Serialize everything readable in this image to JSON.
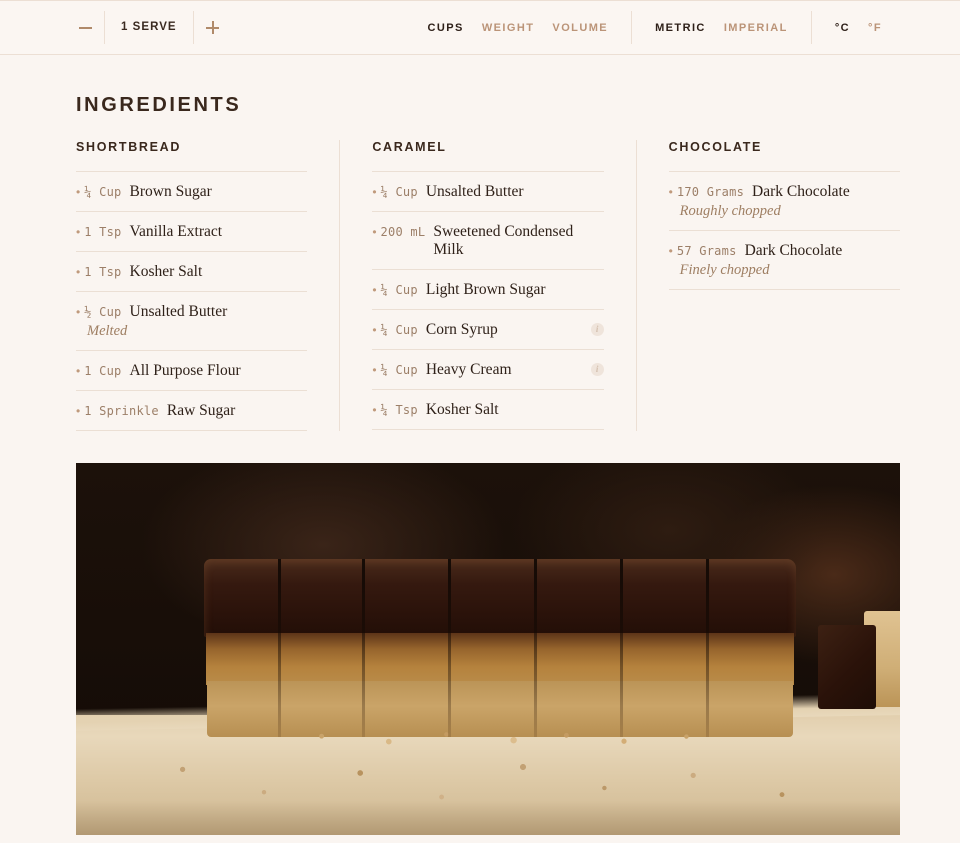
{
  "topbar": {
    "decrease_label": "minus-icon",
    "serves_label": "1 SERVE",
    "increase_label": "plus-icon",
    "measure_toggles": [
      {
        "label": "CUPS",
        "active": true
      },
      {
        "label": "WEIGHT",
        "active": false
      },
      {
        "label": "VOLUME",
        "active": false
      }
    ],
    "system_toggles": [
      {
        "label": "METRIC",
        "active": true
      },
      {
        "label": "IMPERIAL",
        "active": false
      }
    ],
    "temperature_toggles": [
      {
        "label": "°C",
        "active": true
      },
      {
        "label": "°F",
        "active": false
      }
    ]
  },
  "main": {
    "title": "INGREDIENTS",
    "columns": [
      {
        "heading": "SHORTBREAD",
        "items": [
          {
            "bullet": "•",
            "amount": "¼ Cup",
            "name": "Brown Sugar",
            "note": "",
            "info": false
          },
          {
            "bullet": "•",
            "amount": "1 Tsp",
            "name": "Vanilla Extract",
            "note": "",
            "info": false
          },
          {
            "bullet": "•",
            "amount": "1 Tsp",
            "name": "Kosher Salt",
            "note": "",
            "info": false
          },
          {
            "bullet": "•",
            "amount": "½ Cup",
            "name": "Unsalted Butter",
            "note": "Melted",
            "info": false
          },
          {
            "bullet": "•",
            "amount": "1 Cup",
            "name": "All Purpose Flour",
            "note": "",
            "info": false
          },
          {
            "bullet": "•",
            "amount": "1 Sprinkle",
            "name": "Raw Sugar",
            "note": "",
            "info": false
          }
        ]
      },
      {
        "heading": "CARAMEL",
        "items": [
          {
            "bullet": "•",
            "amount": "¼ Cup",
            "name": "Unsalted Butter",
            "note": "",
            "info": false
          },
          {
            "bullet": "•",
            "amount": "200 mL",
            "name": "Sweetened Condensed Milk",
            "note": "",
            "info": false
          },
          {
            "bullet": "•",
            "amount": "¼ Cup",
            "name": "Light Brown Sugar",
            "note": "",
            "info": false
          },
          {
            "bullet": "•",
            "amount": "¼ Cup",
            "name": "Corn Syrup",
            "note": "",
            "info": true
          },
          {
            "bullet": "•",
            "amount": "¼ Cup",
            "name": "Heavy Cream",
            "note": "",
            "info": true
          },
          {
            "bullet": "•",
            "amount": "¼ Tsp",
            "name": "Kosher Salt",
            "note": "",
            "info": false
          }
        ]
      },
      {
        "heading": "CHOCOLATE",
        "items": [
          {
            "bullet": "•",
            "amount": "170 Grams",
            "name": "Dark Chocolate",
            "note": "Roughly chopped",
            "info": false
          },
          {
            "bullet": "•",
            "amount": "57 Grams",
            "name": "Dark Chocolate",
            "note": "Finely chopped",
            "info": false
          }
        ]
      }
    ]
  },
  "photo": {
    "name": "recipe-photo",
    "alt": "Sliced millionaire shortbread bars with chocolate top on a wooden board"
  },
  "colors": {
    "background": "#faf5f1",
    "topbar_background": "#fbf6f2",
    "rule": "#ebdfd4",
    "text_dark": "#2f2119",
    "text_muted": "#9c7f68",
    "accent": "#b08a6a"
  },
  "icons": {
    "info": "i"
  }
}
